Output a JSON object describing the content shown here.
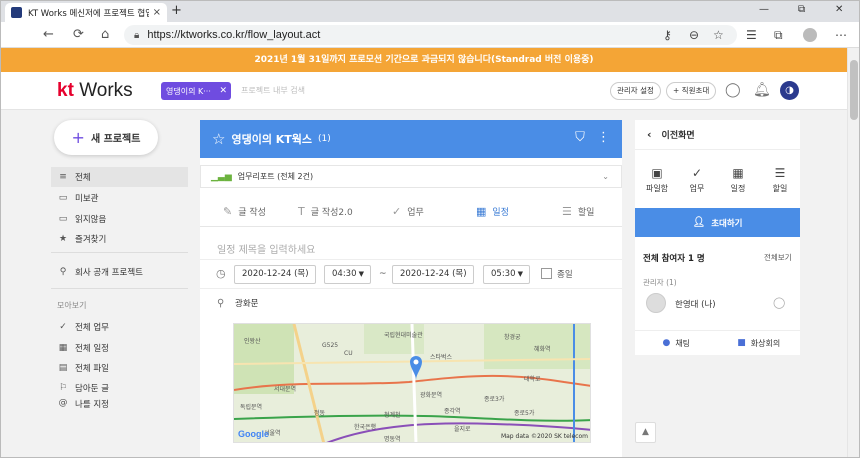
{
  "browser": {
    "tab_title": "KT Works 메신저에 프로젝트 협업",
    "tab_close": "×",
    "new_tab": "+",
    "url": "https://ktworks.co.kr/flow_layout.act",
    "minimize": "—",
    "restore": "⧉",
    "close": "✕"
  },
  "banner": {
    "text": "2021년 1월 31일까지 프로모션 기간으로 과금되지 않습니다(Standrad 버전 이용중)"
  },
  "header": {
    "logo_kt": "kt",
    "logo_works": "Works",
    "chip_label": "영댕이의 K···",
    "chip_close": "✕",
    "search_placeholder": "프로젝트 내부 검색",
    "admin_settings": "관리자 설정",
    "invite_staff": "직원초대",
    "avatar_glyph": "◑"
  },
  "sidebar": {
    "new_project": "새 프로젝트",
    "items": [
      {
        "label": "전체",
        "icon": "≡"
      },
      {
        "label": "미보관",
        "icon": "▭"
      },
      {
        "label": "읽지않음",
        "icon": "▭"
      },
      {
        "label": "즐겨찾기",
        "icon": "★"
      }
    ],
    "public_projects": "회사 공개 프로젝트",
    "section_title": "모아보기",
    "collect_items": [
      {
        "label": "전체 업무",
        "icon": "✓"
      },
      {
        "label": "전체 일정",
        "icon": "▦"
      },
      {
        "label": "전체 파일",
        "icon": "▤"
      },
      {
        "label": "담아둔 글",
        "icon": "⚐"
      },
      {
        "label": "나를 지정",
        "icon": "@"
      }
    ]
  },
  "project": {
    "title": "영댕이의 KT웍스",
    "count": "(1)",
    "report_label": "업무리포트 (전체 2건)",
    "tabs": [
      {
        "label": "글 작성",
        "icon": "✎"
      },
      {
        "label": "글 작성2.0",
        "icon": "T"
      },
      {
        "label": "업무",
        "icon": "✓"
      },
      {
        "label": "일정",
        "icon": "▦"
      },
      {
        "label": "할일",
        "icon": "☰"
      }
    ],
    "schedule_title_placeholder": "일정 제목을 입력하세요",
    "start_date": "2020-12-24 (목)",
    "start_time": "04:30",
    "tilde": "~",
    "end_date": "2020-12-24 (목)",
    "end_time": "05:30",
    "allday_label": "종일",
    "location": "광화문"
  },
  "map": {
    "google": "Google",
    "copyright": "Map data ©2020 SK telecom",
    "labels": [
      "G525",
      "CU",
      "스타벅스",
      "인왕산",
      "독립문역",
      "광화문역",
      "종로3가",
      "을지로",
      "명동역",
      "한국은행",
      "서울역",
      "정동",
      "국립현대미술관",
      "창경궁",
      "종각역",
      "청계천",
      "서대문역",
      "혜화역",
      "대학로",
      "종로5가"
    ]
  },
  "right_panel": {
    "back_label": "이전화면",
    "actions": [
      {
        "label": "파일함",
        "icon": "▣"
      },
      {
        "label": "업무",
        "icon": "✓"
      },
      {
        "label": "일정",
        "icon": "▦"
      },
      {
        "label": "할일",
        "icon": "☰"
      }
    ],
    "invite_button": "초대하기",
    "participants_title": "전체 참여자 1 명",
    "view_all": "전체보기",
    "manager_label": "관리자 (1)",
    "user_name": "한영대 (나)",
    "chat_label": "채팅",
    "video_label": "화상회의"
  },
  "colors": {
    "banner": "#f4a536",
    "primary_blue": "#4a8de6",
    "chip_purple": "#6f4ce0",
    "kt_red": "#e6002d"
  }
}
